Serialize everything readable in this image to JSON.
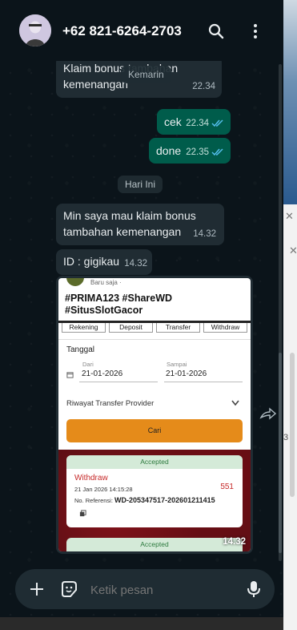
{
  "header": {
    "contact": "+62 821-6264-2703",
    "search_icon": "search-icon",
    "menu_icon": "more-vert-icon"
  },
  "messages": {
    "m1_text": "Klaim bonus tambahan kemenangan",
    "m1_time": "22.34",
    "date_kemarin": "Kemarin",
    "m2_text": "cek",
    "m2_time": "22.34",
    "m3_text": "done",
    "m3_time": "22.35",
    "date_today": "Hari Ini",
    "m4_line1": "Min saya mau klaim bonus",
    "m4_line2": "tambahan kemenangan",
    "m4_time": "14.32",
    "m5_text": "ID : gigikau",
    "m5_time": "14.32",
    "img_time": "14.32"
  },
  "screenshot": {
    "posted": "Baru saja · ",
    "hashtags_line1": "#PRIMA123 #ShareWD",
    "hashtags_line2": "#SitusSlotGacor",
    "tabs": [
      "Rekening",
      "Deposit",
      "Transfer",
      "Withdraw"
    ],
    "section": "Tanggal",
    "from_label": "Dari",
    "from_date": "21-01-2026",
    "to_label": "Sampai",
    "to_date": "21-01-2026",
    "provider": "Riwayat Transfer Provider",
    "cari": "Cari",
    "status": "Accepted",
    "wd_title": "Withdraw",
    "wd_date": "21 Jan 2026 14:15:28",
    "wd_amount": "551",
    "ref_label": "No. Referensi:",
    "ref_value": "WD-205347517-202601211415",
    "status2": "Accepted"
  },
  "composer": {
    "placeholder": "Ketik pesan",
    "add_icon": "plus-icon",
    "sticker_icon": "sticker-icon",
    "mic_icon": "mic-icon"
  },
  "colors": {
    "background": "#0b141a",
    "incoming": "#202c33",
    "outgoing": "#005c4b",
    "tick": "#53bdeb",
    "orange": "#e58b1a"
  }
}
